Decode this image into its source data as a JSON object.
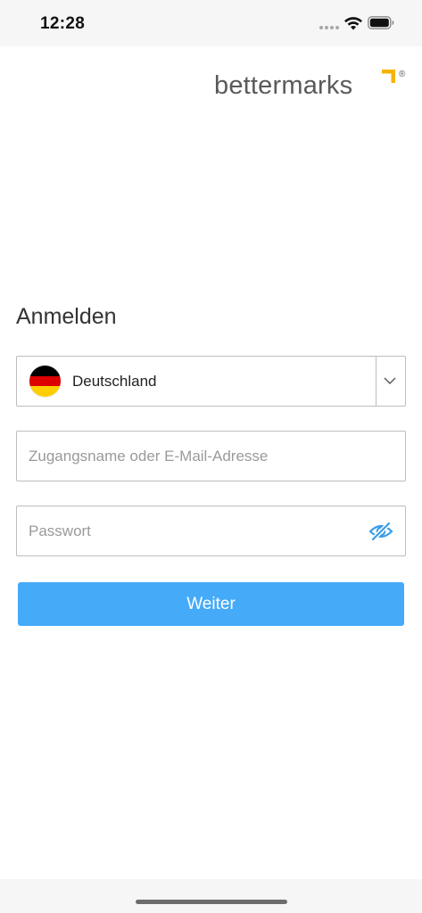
{
  "status_bar": {
    "time": "12:28",
    "wifi_icon": "wifi-icon",
    "battery_icon": "battery-icon"
  },
  "logo": {
    "text": "bettermarks",
    "registered": "®",
    "accent_color": "#f5b400"
  },
  "login": {
    "title": "Anmelden",
    "country": {
      "selected": "Deutschland",
      "flag_colors": [
        "#000000",
        "#dd0000",
        "#ffce00"
      ],
      "chevron_icon": "chevron-down-icon"
    },
    "username": {
      "placeholder": "Zugangsname oder E-Mail-Adresse",
      "value": ""
    },
    "password": {
      "placeholder": "Passwort",
      "value": "",
      "toggle_icon": "eye-slash-icon"
    },
    "submit_label": "Weiter"
  },
  "colors": {
    "primary": "#45aaf8",
    "border": "#bdbdbd",
    "text": "#333333",
    "placeholder": "#9a9a9a"
  }
}
